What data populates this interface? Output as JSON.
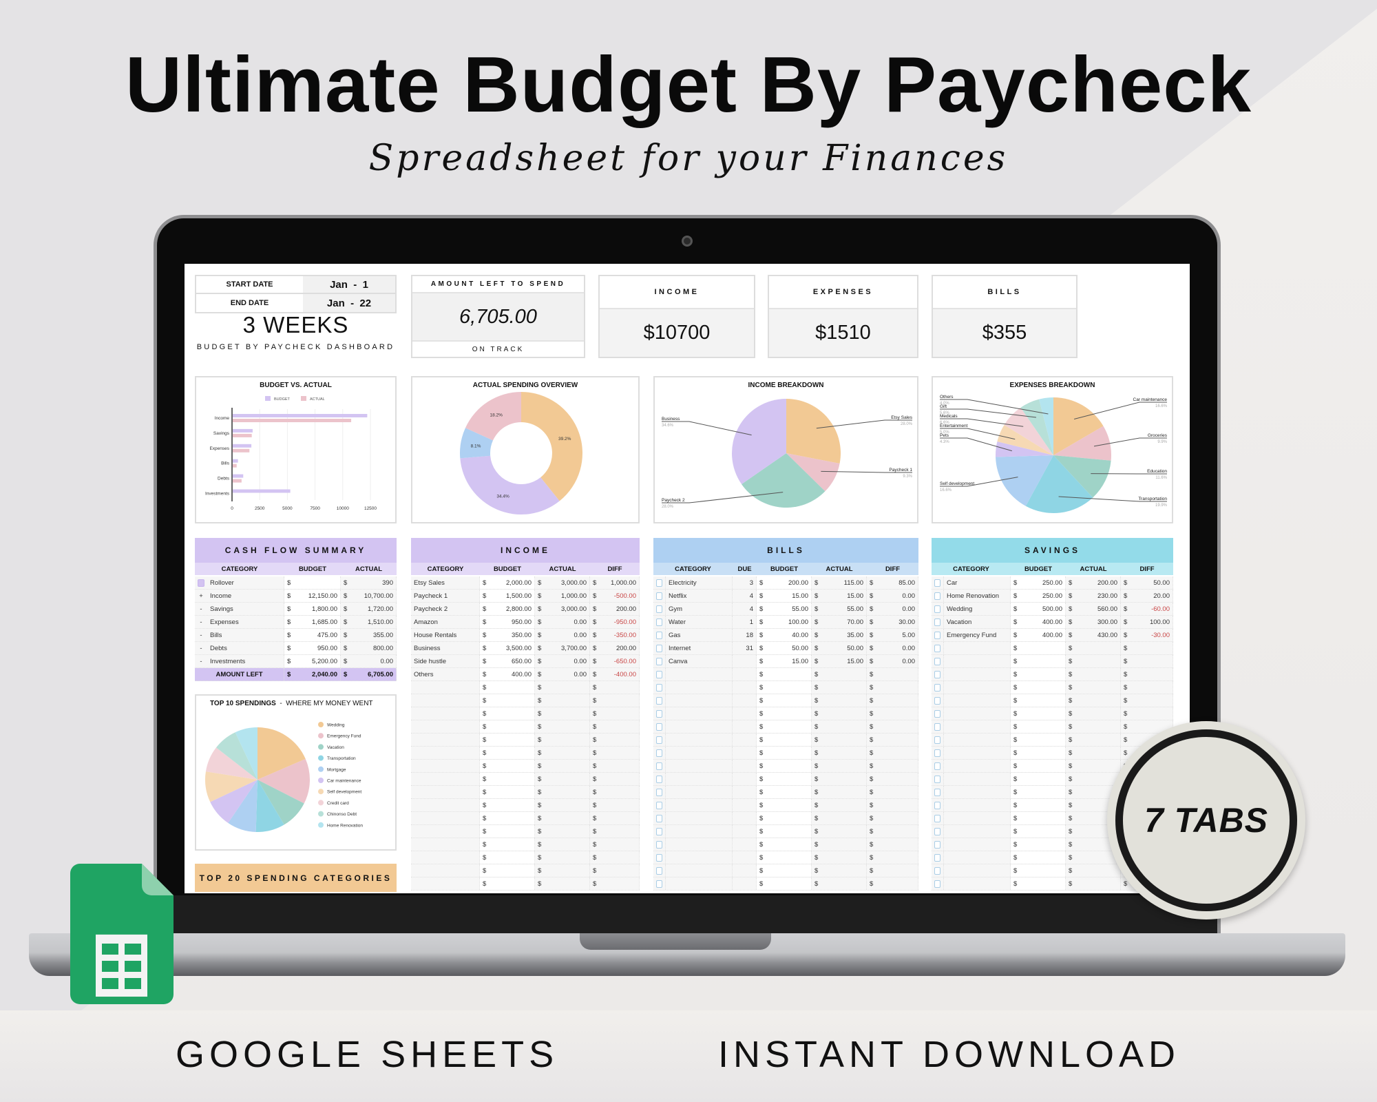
{
  "hero": {
    "title": "Ultimate Budget By Paycheck",
    "subtitle": "Spreadsheet for your Finances"
  },
  "footer": {
    "left": "GOOGLE SHEETS",
    "right": "INSTANT DOWNLOAD"
  },
  "badge": {
    "text": "7 TABS"
  },
  "colors": {
    "purple": "#d3c4f2",
    "blue": "#aed0f2",
    "cyan": "#93dbe9",
    "orange": "#f2c994",
    "negative": "#c84444",
    "sheets_green": "#1fa463"
  },
  "currency": "$",
  "dashboard": {
    "start_label": "START DATE",
    "start_value": "Jan  -  1",
    "end_label": "END DATE",
    "end_value": "Jan  -  22",
    "duration": "3 WEEKS",
    "subtitle": "BUDGET BY PAYCHECK DASHBOARD",
    "amount_left": {
      "label": "AMOUNT LEFT TO SPEND",
      "value": "6,705.00",
      "status": "ON TRACK"
    },
    "kpis": [
      {
        "label": "INCOME",
        "value": "$10700"
      },
      {
        "label": "EXPENSES",
        "value": "$1510"
      },
      {
        "label": "BILLS",
        "value": "$355"
      }
    ]
  },
  "cash_flow": {
    "title": "CASH FLOW SUMMARY",
    "columns": [
      "CATEGORY",
      "BUDGET",
      "ACTUAL"
    ],
    "rows": [
      {
        "sign": "",
        "checked": true,
        "category": "Rollover",
        "budget": "",
        "actual": "390"
      },
      {
        "sign": "+",
        "category": "Income",
        "budget": "12,150.00",
        "actual": "10,700.00"
      },
      {
        "sign": "-",
        "category": "Savings",
        "budget": "1,800.00",
        "actual": "1,720.00"
      },
      {
        "sign": "-",
        "category": "Expenses",
        "budget": "1,685.00",
        "actual": "1,510.00"
      },
      {
        "sign": "-",
        "category": "Bills",
        "budget": "475.00",
        "actual": "355.00"
      },
      {
        "sign": "-",
        "category": "Debts",
        "budget": "950.00",
        "actual": "800.00"
      },
      {
        "sign": "-",
        "category": "Investments",
        "budget": "5,200.00",
        "actual": "0.00"
      }
    ],
    "total": {
      "label": "AMOUNT LEFT",
      "budget": "2,040.00",
      "actual": "6,705.00"
    }
  },
  "income": {
    "title": "INCOME",
    "columns": [
      "CATEGORY",
      "BUDGET",
      "ACTUAL",
      "DIFF"
    ],
    "rows": [
      {
        "category": "Etsy Sales",
        "budget": "2,000.00",
        "actual": "3,000.00",
        "diff": "1,000.00"
      },
      {
        "category": "Paycheck 1",
        "budget": "1,500.00",
        "actual": "1,000.00",
        "diff": "-500.00"
      },
      {
        "category": "Paycheck 2",
        "budget": "2,800.00",
        "actual": "3,000.00",
        "diff": "200.00"
      },
      {
        "category": "Amazon",
        "budget": "950.00",
        "actual": "0.00",
        "diff": "-950.00"
      },
      {
        "category": "House Rentals",
        "budget": "350.00",
        "actual": "0.00",
        "diff": "-350.00"
      },
      {
        "category": "Business",
        "budget": "3,500.00",
        "actual": "3,700.00",
        "diff": "200.00"
      },
      {
        "category": "Side hustle",
        "budget": "650.00",
        "actual": "0.00",
        "diff": "-650.00"
      },
      {
        "category": "Others",
        "budget": "400.00",
        "actual": "0.00",
        "diff": "-400.00"
      }
    ]
  },
  "bills": {
    "title": "BILLS",
    "columns": [
      "CATEGORY",
      "DUE",
      "BUDGET",
      "ACTUAL",
      "DIFF"
    ],
    "rows": [
      {
        "category": "Electricity",
        "due": "3",
        "budget": "200.00",
        "actual": "115.00",
        "diff": "85.00"
      },
      {
        "category": "Netflix",
        "due": "4",
        "budget": "15.00",
        "actual": "15.00",
        "diff": "0.00"
      },
      {
        "category": "Gym",
        "due": "4",
        "budget": "55.00",
        "actual": "55.00",
        "diff": "0.00"
      },
      {
        "category": "Water",
        "due": "1",
        "budget": "100.00",
        "actual": "70.00",
        "diff": "30.00"
      },
      {
        "category": "Gas",
        "due": "18",
        "budget": "40.00",
        "actual": "35.00",
        "diff": "5.00"
      },
      {
        "category": "Internet",
        "due": "31",
        "budget": "50.00",
        "actual": "50.00",
        "diff": "0.00"
      },
      {
        "category": "Canva",
        "due": "",
        "budget": "15.00",
        "actual": "15.00",
        "diff": "0.00"
      }
    ]
  },
  "savings": {
    "title": "SAVINGS",
    "columns": [
      "CATEGORY",
      "BUDGET",
      "ACTUAL",
      "DIFF"
    ],
    "rows": [
      {
        "category": "Car",
        "budget": "250.00",
        "actual": "200.00",
        "diff": "50.00"
      },
      {
        "category": "Home Renovation",
        "budget": "250.00",
        "actual": "230.00",
        "diff": "20.00"
      },
      {
        "category": "Wedding",
        "budget": "500.00",
        "actual": "560.00",
        "diff": "-60.00"
      },
      {
        "category": "Vacation",
        "budget": "400.00",
        "actual": "300.00",
        "diff": "100.00"
      },
      {
        "category": "Emergency Fund",
        "budget": "400.00",
        "actual": "430.00",
        "diff": "-30.00"
      }
    ]
  },
  "top20": {
    "title": "TOP 20 SPENDING CATEGORIES"
  },
  "chart_data": [
    {
      "id": "budget_vs_actual",
      "type": "bar",
      "orientation": "horizontal",
      "title": "BUDGET VS. ACTUAL",
      "categories": [
        "Income",
        "Savings",
        "Expenses",
        "Bills",
        "Debts",
        "Investments"
      ],
      "series": [
        {
          "name": "BUDGET",
          "color": "#d3c4f2",
          "values": [
            12150,
            1800,
            1685,
            475,
            950,
            5200
          ]
        },
        {
          "name": "ACTUAL",
          "color": "#ecc3cb",
          "values": [
            10700,
            1720,
            1510,
            355,
            800,
            0
          ]
        }
      ],
      "xticks": [
        "0",
        "2500",
        "5000",
        "7500",
        "10000",
        "12500"
      ],
      "xlim": [
        0,
        12500
      ],
      "grid": true,
      "legend": "top"
    },
    {
      "id": "actual_spending",
      "type": "pie",
      "donut": true,
      "title": "ACTUAL SPENDING OVERVIEW",
      "values": [
        39.2,
        34.4,
        8.1,
        18.2
      ],
      "labels": [
        "39.2%",
        "34.4%",
        "8.1%",
        "18.2%"
      ],
      "colors": [
        "#f2c994",
        "#d3c4f2",
        "#aed0f2",
        "#ecc3cb"
      ]
    },
    {
      "id": "income_breakdown",
      "type": "pie",
      "title": "INCOME BREAKDOWN",
      "categories": [
        "Etsy Sales",
        "Paycheck 1",
        "Paycheck 2",
        "Business"
      ],
      "values": [
        28.0,
        9.3,
        28.0,
        34.6
      ],
      "labels": [
        "28.0%",
        "9.3%",
        "28.0%",
        "34.6%"
      ],
      "colors": [
        "#f2c994",
        "#ecc3cb",
        "#9fd3c7",
        "#d3c4f2"
      ]
    },
    {
      "id": "expenses_breakdown",
      "type": "pie",
      "title": "EXPENSES BREAKDOWN",
      "categories": [
        "Car maintenance",
        "Groceries",
        "Education",
        "Transportation",
        "Self development",
        "Pets",
        "Entertainment",
        "Medicals",
        "Gift",
        "Others"
      ],
      "values": [
        16.6,
        9.9,
        11.6,
        19.9,
        16.6,
        4.3,
        5.0,
        6.6,
        5.6,
        4.0
      ],
      "labels": [
        "16.6%",
        "9.9%",
        "11.6%",
        "19.9%",
        "16.6%",
        "4.3%",
        "5.0%",
        "6.6%",
        "5.6%",
        "4.0%"
      ],
      "colors": [
        "#f2c994",
        "#ecc3cb",
        "#9fd3c7",
        "#8fd5e4",
        "#aed0f2",
        "#d3c4f2",
        "#f6d9b4",
        "#f2d3d8",
        "#b7e0d8",
        "#b3e4ef"
      ]
    },
    {
      "id": "top10_spendings",
      "type": "pie",
      "title": "TOP 10 SPENDINGS",
      "subtitle": "WHERE MY MONEY WENT",
      "categories": [
        "Wedding",
        "Emergency Fund",
        "Vacation",
        "Transportation",
        "Mortgage",
        "Car maintenance",
        "Self development",
        "Credit card",
        "Chinonso Debt",
        "Home Renovation"
      ],
      "values": [
        18.5,
        14,
        9,
        9,
        9,
        8.5,
        9.5,
        8,
        7.5,
        7
      ],
      "colors": [
        "#f2c994",
        "#ecc3cb",
        "#9fd3c7",
        "#8fd5e4",
        "#aed0f2",
        "#d3c4f2",
        "#f6d9b4",
        "#f2d3d8",
        "#b7e0d8",
        "#b3e4ef"
      ],
      "legend": "right"
    }
  ]
}
